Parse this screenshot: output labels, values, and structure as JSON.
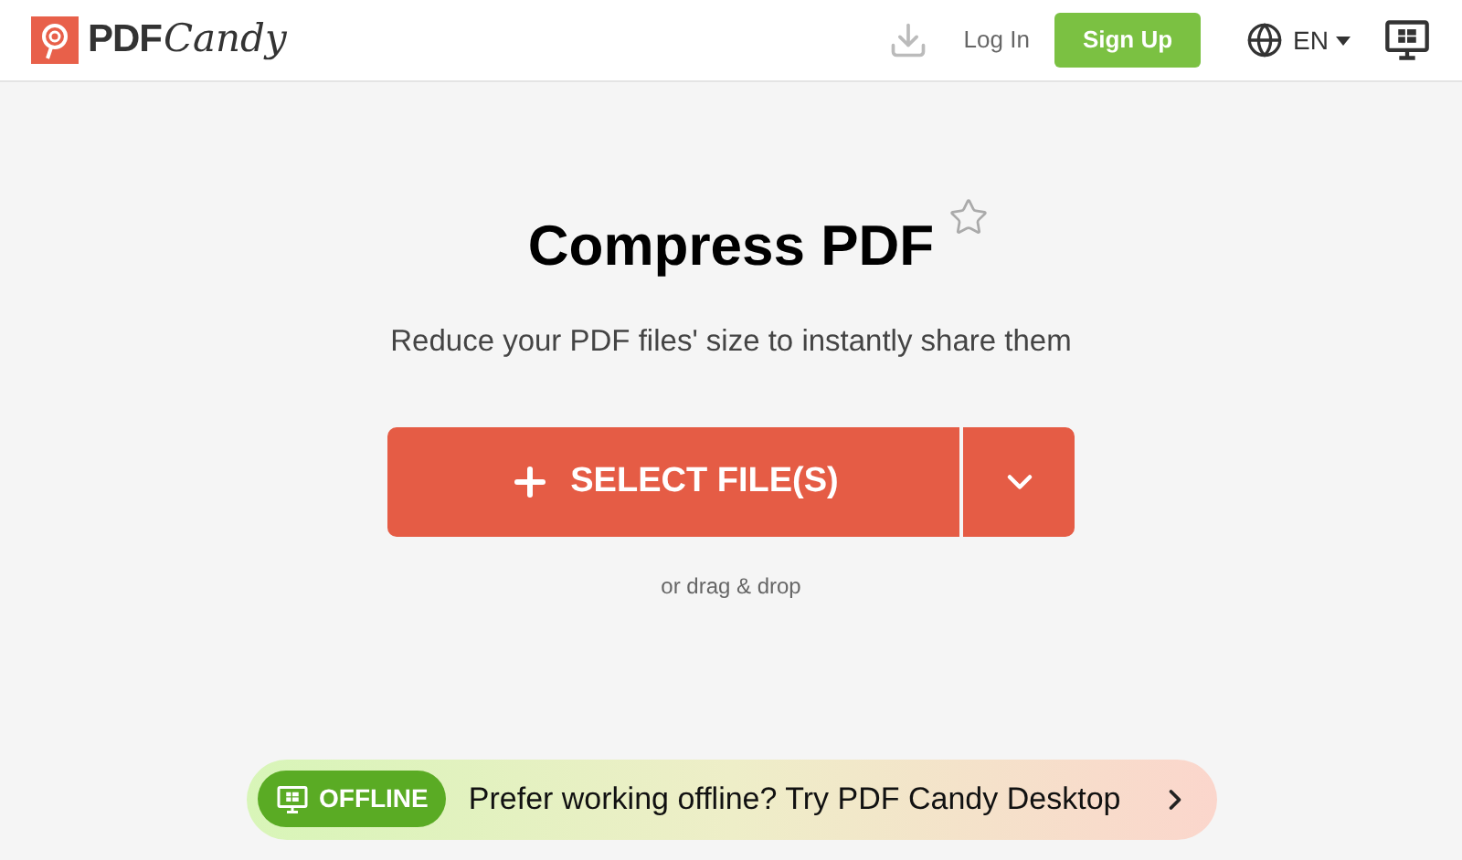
{
  "header": {
    "logo": {
      "part_1": "PDF",
      "part_2": "Candy"
    },
    "login": "Log In",
    "signup": "Sign Up",
    "language": "EN"
  },
  "main": {
    "title": "Compress PDF",
    "subtitle": "Reduce your PDF files' size to instantly share them",
    "select_button": "SELECT FILE(S)",
    "drop_hint": "or drag & drop"
  },
  "banner": {
    "badge": "OFFLINE",
    "text": "Prefer working offline? Try PDF Candy Desktop"
  }
}
